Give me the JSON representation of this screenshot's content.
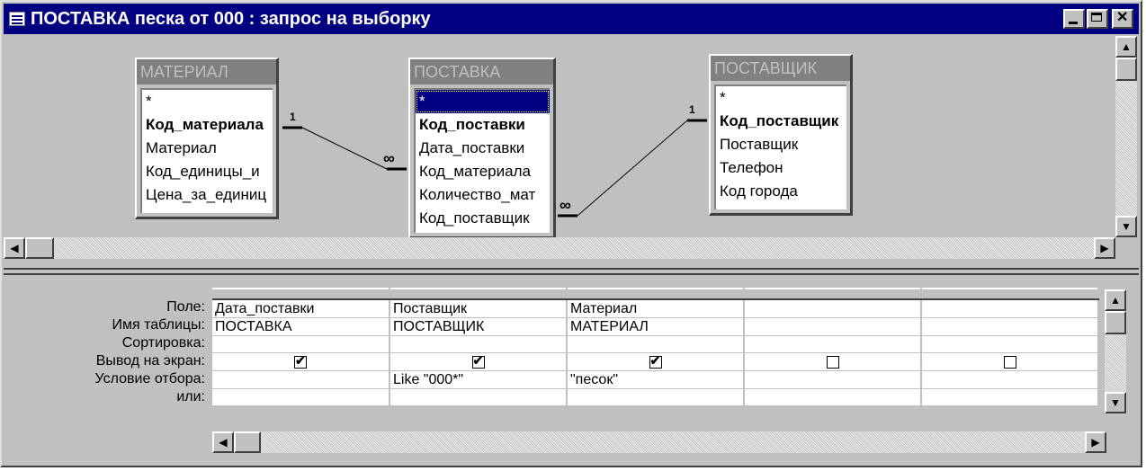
{
  "window": {
    "title": "ПОСТАВКА  песка от 000 : запрос на выборку",
    "icon": "query-icon"
  },
  "tables": [
    {
      "name": "МАТЕРИАЛ",
      "fields": [
        "*",
        "Код_материала",
        "Материал",
        "Код_единицы_и",
        "Цена_за_единиц"
      ],
      "key_index": 1
    },
    {
      "name": "ПОСТАВКА",
      "fields": [
        "*",
        "Код_поставки",
        "Дата_поставки",
        "Код_материала",
        "Количество_мат",
        "Код_поставщик"
      ],
      "key_index": 1,
      "selected_index": 0
    },
    {
      "name": "ПОСТАВЩИК",
      "fields": [
        "*",
        "Код_поставщик",
        "Поставщик",
        "Телефон",
        "Код города"
      ],
      "key_index": 1
    }
  ],
  "relations": [
    {
      "one_label": "1",
      "many_label": "∞"
    },
    {
      "one_label": "1",
      "many_label": "∞"
    }
  ],
  "grid": {
    "row_labels": [
      "Поле:",
      "Имя таблицы:",
      "Сортировка:",
      "Вывод на экран:",
      "Условие отбора:",
      "или:"
    ],
    "columns": [
      {
        "field": "Дата_поставки",
        "table": "ПОСТАВКА",
        "sort": "",
        "show": true,
        "criteria": "",
        "or": ""
      },
      {
        "field": "Поставщик",
        "table": "ПОСТАВЩИК",
        "sort": "",
        "show": true,
        "criteria": "Like \"000*\"",
        "or": ""
      },
      {
        "field": "Материал",
        "table": "МАТЕРИАЛ",
        "sort": "",
        "show": true,
        "criteria": "\"песок\"",
        "or": ""
      },
      {
        "field": "",
        "table": "",
        "sort": "",
        "show": false,
        "criteria": "",
        "or": ""
      },
      {
        "field": "",
        "table": "",
        "sort": "",
        "show": false,
        "criteria": "",
        "or": ""
      }
    ]
  },
  "colors": {
    "titlebar": "#000080",
    "face": "#c0c0c0",
    "selection": "#000080"
  }
}
